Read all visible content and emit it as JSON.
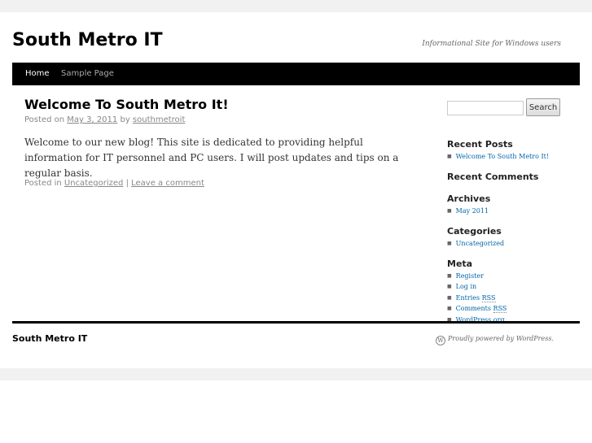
{
  "site": {
    "title": "South Metro IT",
    "description": "Informational Site for Windows users"
  },
  "nav": {
    "items": [
      {
        "label": "Home",
        "active": true
      },
      {
        "label": "Sample Page",
        "active": false
      }
    ]
  },
  "post": {
    "title": "Welcome To South Metro It!",
    "meta_prefix": "Posted on",
    "date": "May 3, 2011",
    "by": "by",
    "author": "southmetroit",
    "body": "Welcome to our new blog!  This site is dedicated to providing helpful information for IT personnel and PC users.  I will post updates and tips on a regular basis.",
    "posted_in_label": "Posted in",
    "category": "Uncategorized",
    "separator": "|",
    "comment_link": "Leave a comment"
  },
  "sidebar": {
    "search_placeholder": "",
    "search_button": "Search",
    "recent_posts": {
      "title": "Recent Posts",
      "items": [
        "Welcome To South Metro It!"
      ]
    },
    "recent_comments": {
      "title": "Recent Comments"
    },
    "archives": {
      "title": "Archives",
      "items": [
        "May 2011"
      ]
    },
    "categories": {
      "title": "Categories",
      "items": [
        "Uncategorized"
      ]
    },
    "meta": {
      "title": "Meta",
      "register": "Register",
      "login": "Log in",
      "entries_prefix": "Entries",
      "entries_abbr": "RSS",
      "comments_prefix": "Comments",
      "comments_abbr": "RSS",
      "wordpress": "WordPress.org"
    }
  },
  "footer": {
    "title": "South Metro IT",
    "powered": "Proudly powered by WordPress.",
    "icon": "wordpress-icon"
  },
  "colors": {
    "nav_bg": "#000000",
    "link": "#0066aa",
    "band": "#f1f1f1"
  }
}
